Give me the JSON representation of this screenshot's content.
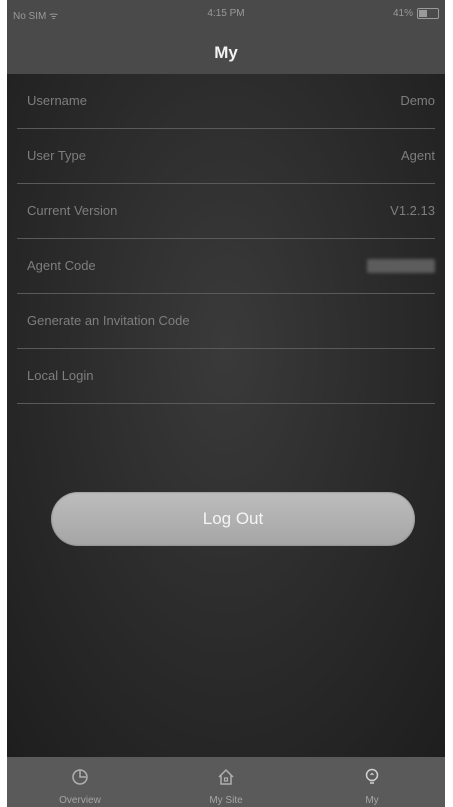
{
  "status_bar": {
    "carrier": "No SIM ᯤ",
    "time": "4:15 PM",
    "battery": "41%"
  },
  "header": {
    "title": "My"
  },
  "rows": [
    {
      "label": "Username",
      "value": "Demo"
    },
    {
      "label": "User Type",
      "value": "Agent"
    },
    {
      "label": "Current Version",
      "value": "V1.2.13"
    },
    {
      "label": "Agent Code",
      "value": ""
    },
    {
      "label": "Generate an Invitation Code",
      "value": ""
    },
    {
      "label": "Local Login",
      "value": ""
    }
  ],
  "logout_label": "Log Out",
  "tabs": [
    {
      "label": "Overview",
      "icon": "pie-chart-icon"
    },
    {
      "label": "My Site",
      "icon": "home-icon"
    },
    {
      "label": "My",
      "icon": "lightbulb-icon"
    }
  ],
  "colors": {
    "nav_background": "#4a4a4a",
    "content_background": "#2a2a2a",
    "tabbar_background": "#5a5a5a",
    "logout_button": "#b3b3b3"
  }
}
